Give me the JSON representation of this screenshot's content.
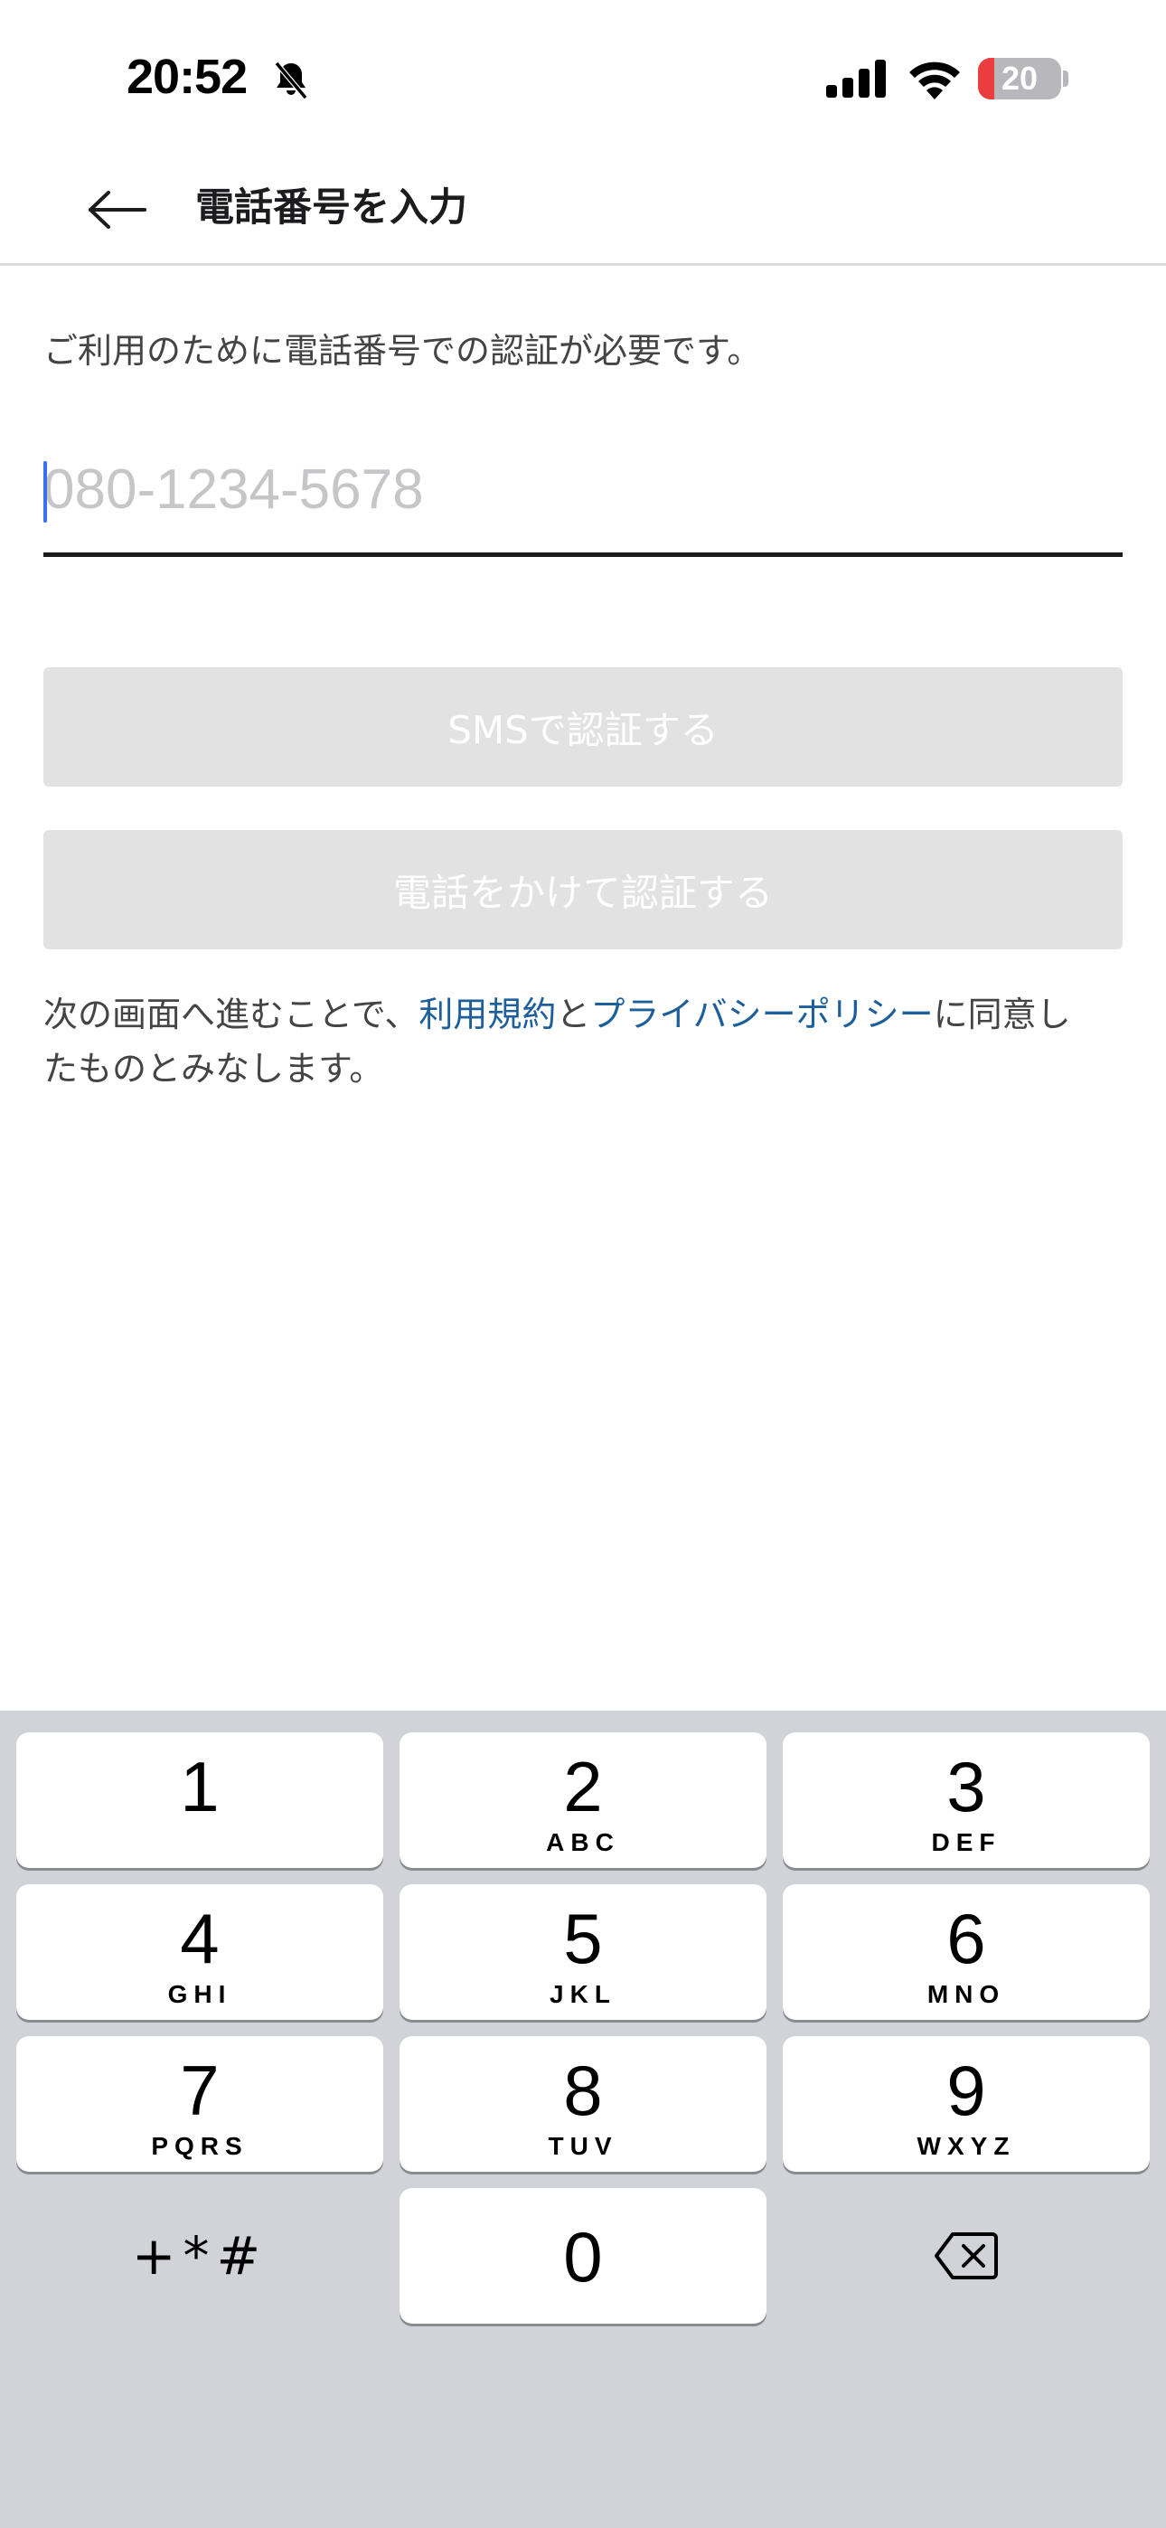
{
  "status_bar": {
    "time": "20:52",
    "battery_level": "20",
    "battery_fraction": 0.2,
    "icons": [
      "bell-slash-icon",
      "cellular-signal-icon",
      "wifi-icon",
      "battery-icon"
    ]
  },
  "nav": {
    "back_icon": "arrow-left-icon",
    "title": "電話番号を入力"
  },
  "form": {
    "description": "ご利用のために電話番号での認証が必要です。",
    "phone_placeholder": "080-1234-5678",
    "phone_value": "",
    "sms_button": "SMSで認証する",
    "call_button": "電話をかけて認証する"
  },
  "terms": {
    "prefix": "次の画面へ進むことで、",
    "terms_link": "利用規約",
    "conjunction": "と",
    "privacy_link": "プライバシーポリシー",
    "suffix_line1": "に同意し",
    "suffix_line2": "たものとみなします。"
  },
  "keypad": {
    "keys": [
      {
        "num": "1",
        "letters": ""
      },
      {
        "num": "2",
        "letters": "ABC"
      },
      {
        "num": "3",
        "letters": "DEF"
      },
      {
        "num": "4",
        "letters": "GHI"
      },
      {
        "num": "5",
        "letters": "JKL"
      },
      {
        "num": "6",
        "letters": "MNO"
      },
      {
        "num": "7",
        "letters": "PQRS"
      },
      {
        "num": "8",
        "letters": "TUV"
      },
      {
        "num": "9",
        "letters": "WXYZ"
      }
    ],
    "zero": "0",
    "symbols": "+*#",
    "delete_icon": "delete-backspace-icon"
  },
  "colors": {
    "link": "#1d5f9b",
    "disabled_button": "#e2e2e2",
    "keypad_bg": "#d1d3d9",
    "battery_low": "#eb3d3d"
  }
}
